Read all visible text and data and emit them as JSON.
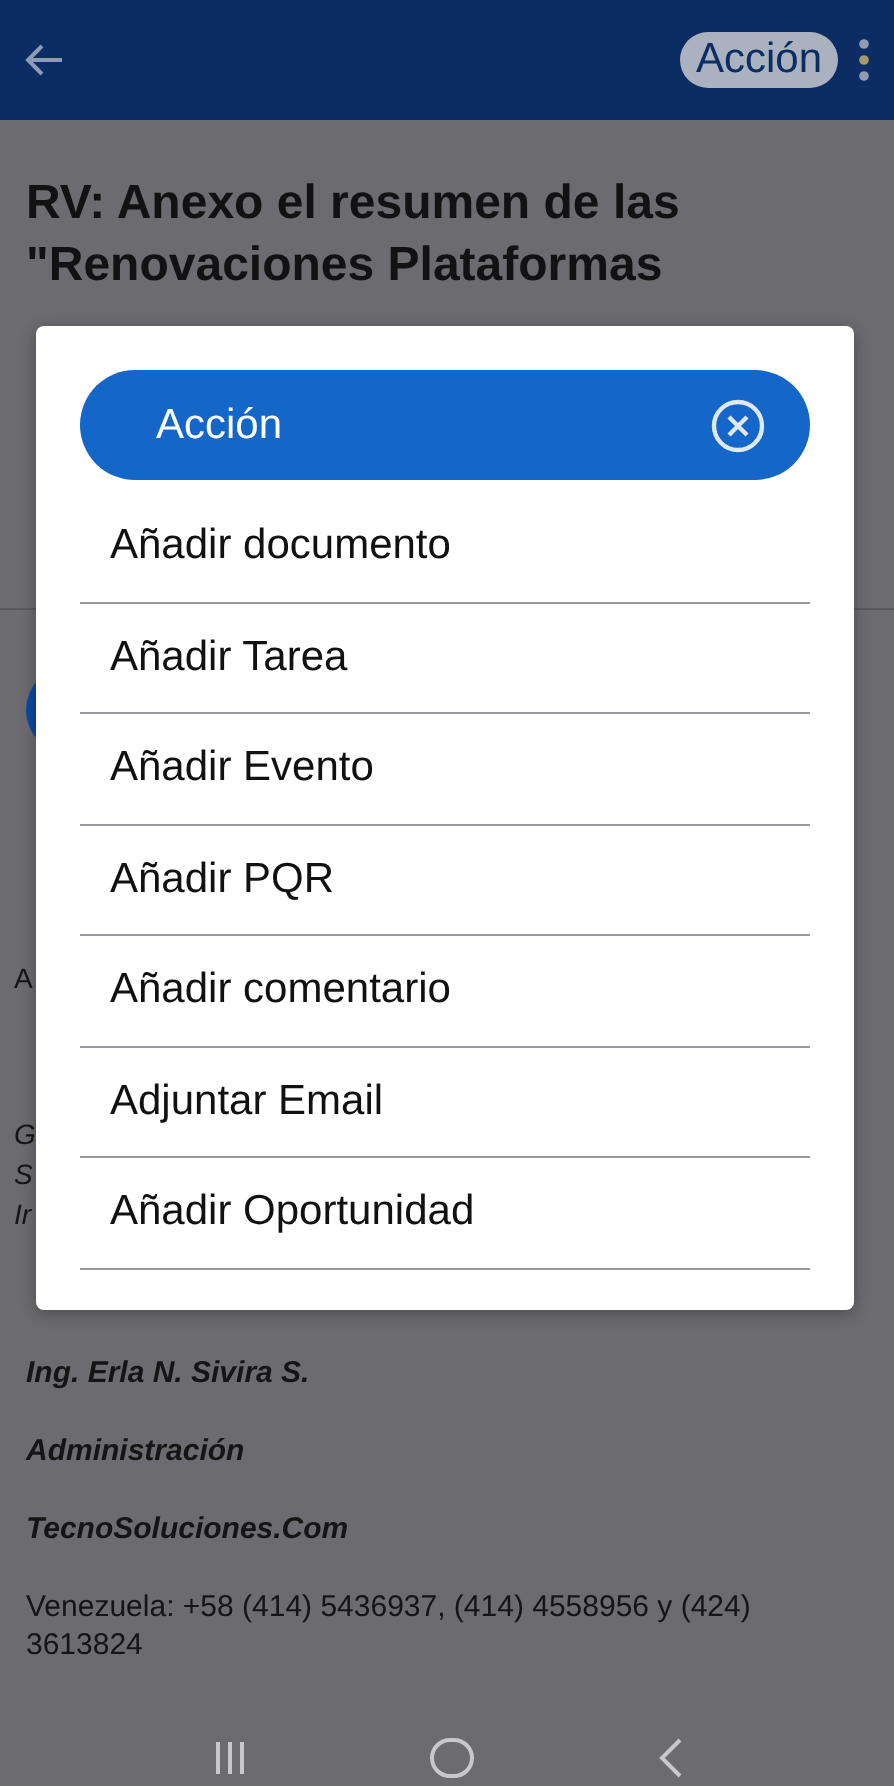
{
  "app_bar": {
    "action_label": "Acción"
  },
  "title_lines": [
    "RV: Anexo el resumen de las",
    "\"Renovaciones Plataformas"
  ],
  "body_fragments": [
    "A",
    "G",
    "S",
    "Ir"
  ],
  "signature": [
    "Ing. Erla N. Sivira S.",
    "Administración",
    "TecnoSoluciones.Com",
    "Venezuela: +58 (414) 5436937, (414) 4558956 y (424) 3613824"
  ],
  "dialog": {
    "title": "Acción",
    "items": [
      "Añadir documento",
      "Añadir Tarea",
      "Añadir Evento",
      "Añadir PQR",
      "Añadir comentario",
      "Adjuntar Email",
      "Añadir Oportunidad"
    ]
  }
}
